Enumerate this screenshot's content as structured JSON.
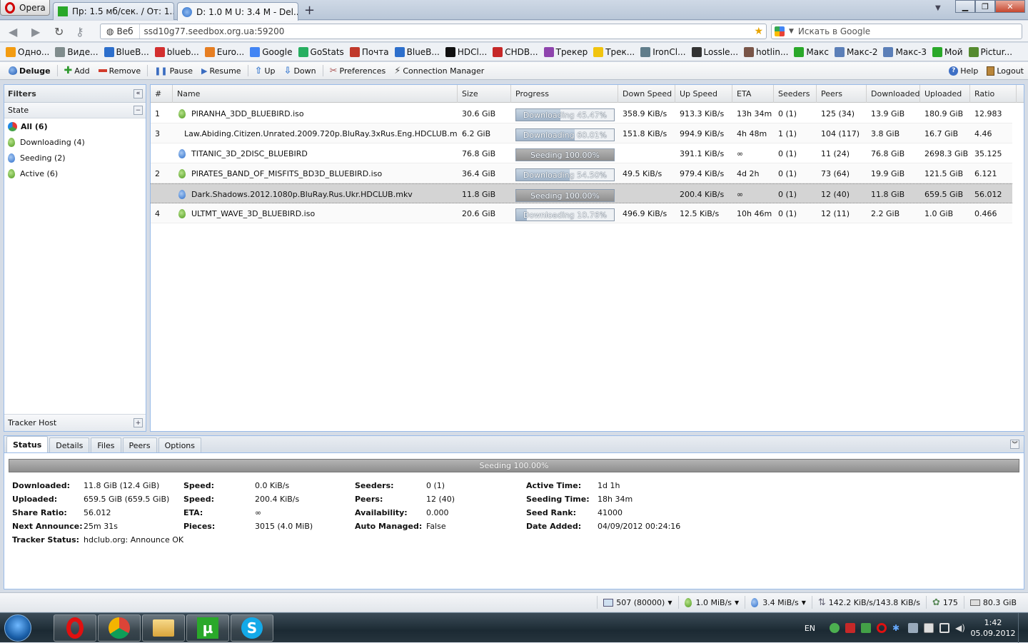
{
  "browser": {
    "menu_label": "Opera",
    "tabs": [
      {
        "title": "Пр: 1.5 мб/сек. / От: 1....",
        "active": false
      },
      {
        "title": "D: 1.0 M U: 3.4 M - Del...",
        "active": true
      }
    ],
    "new_tab": "+",
    "address": {
      "proto": "Веб",
      "url": "ssd10g77.seedbox.org.ua:59200"
    },
    "search_placeholder": "Искать в Google",
    "bookmarks": [
      "Одно...",
      "Виде...",
      "BlueB...",
      "blueb...",
      "Euro...",
      "Google",
      "GoStats",
      "Почта",
      "BlueB...",
      "HDCl...",
      "CHDB...",
      "Трекер",
      "Трек...",
      "IronCl...",
      "Lossle...",
      "hotlin...",
      "Макс",
      "Макс-2",
      "Макс-3",
      "Мой",
      "Pictur..."
    ]
  },
  "toolbar": {
    "brand": "Deluge",
    "add": "Add",
    "remove": "Remove",
    "pause": "Pause",
    "resume": "Resume",
    "up": "Up",
    "down": "Down",
    "preferences": "Preferences",
    "connection_manager": "Connection Manager",
    "help": "Help",
    "logout": "Logout"
  },
  "filters": {
    "title": "Filters",
    "state_header": "State",
    "items": [
      {
        "label": "All (6)",
        "icon": "all-icon",
        "selected": true
      },
      {
        "label": "Downloading (4)",
        "icon": "downloading-icon",
        "selected": false
      },
      {
        "label": "Seeding (2)",
        "icon": "seeding-icon",
        "selected": false
      },
      {
        "label": "Active (6)",
        "icon": "active-icon",
        "selected": false
      }
    ],
    "tracker_host": "Tracker Host"
  },
  "grid": {
    "columns": [
      "#",
      "Name",
      "Size",
      "Progress",
      "Down Speed",
      "Up Speed",
      "ETA",
      "Seeders",
      "Peers",
      "Downloaded",
      "Uploaded",
      "Ratio"
    ],
    "rows": [
      {
        "num": "1",
        "name": "PIRANHA_3DD_BLUEBIRD.iso",
        "size": "30.6 GiB",
        "progress_text": "Downloading 45.47%",
        "progress": 45.47,
        "state": "downloading",
        "down": "358.9 KiB/s",
        "up": "913.3 KiB/s",
        "eta": "13h 34m",
        "seeders": "0 (1)",
        "peers": "125 (34)",
        "downloaded": "13.9 GiB",
        "uploaded": "180.9 GiB",
        "ratio": "12.983",
        "selected": false
      },
      {
        "num": "3",
        "name": "Law.Abiding.Citizen.Unrated.2009.720p.BluRay.3xRus.Eng.HDCLUB.mkv",
        "size": "6.2 GiB",
        "progress_text": "Downloading 60.01%",
        "progress": 60.01,
        "state": "downloading",
        "down": "151.8 KiB/s",
        "up": "994.9 KiB/s",
        "eta": "4h 48m",
        "seeders": "1 (1)",
        "peers": "104 (117)",
        "downloaded": "3.8 GiB",
        "uploaded": "16.7 GiB",
        "ratio": "4.46",
        "selected": false
      },
      {
        "num": "",
        "name": "TITANIC_3D_2DISC_BLUEBIRD",
        "size": "76.8 GiB",
        "progress_text": "Seeding 100.00%",
        "progress": 100,
        "state": "seeding",
        "down": "",
        "up": "391.1 KiB/s",
        "eta": "∞",
        "seeders": "0 (1)",
        "peers": "11 (24)",
        "downloaded": "76.8 GiB",
        "uploaded": "2698.3 GiB",
        "ratio": "35.125",
        "selected": false
      },
      {
        "num": "2",
        "name": "PIRATES_BAND_OF_MISFITS_BD3D_BLUEBIRD.iso",
        "size": "36.4 GiB",
        "progress_text": "Downloading 54.50%",
        "progress": 54.5,
        "state": "downloading",
        "down": "49.5 KiB/s",
        "up": "979.4 KiB/s",
        "eta": "4d 2h",
        "seeders": "0 (1)",
        "peers": "73 (64)",
        "downloaded": "19.9 GiB",
        "uploaded": "121.5 GiB",
        "ratio": "6.121",
        "selected": false
      },
      {
        "num": "",
        "name": "Dark.Shadows.2012.1080p.BluRay.Rus.Ukr.HDCLUB.mkv",
        "size": "11.8 GiB",
        "progress_text": "Seeding 100.00%",
        "progress": 100,
        "state": "seeding",
        "down": "",
        "up": "200.4 KiB/s",
        "eta": "∞",
        "seeders": "0 (1)",
        "peers": "12 (40)",
        "downloaded": "11.8 GiB",
        "uploaded": "659.5 GiB",
        "ratio": "56.012",
        "selected": true
      },
      {
        "num": "4",
        "name": "ULTMT_WAVE_3D_BLUEBIRD.iso",
        "size": "20.6 GiB",
        "progress_text": "Downloading 10.76%",
        "progress": 10.76,
        "state": "downloading",
        "down": "496.9 KiB/s",
        "up": "12.5 KiB/s",
        "eta": "10h 46m",
        "seeders": "0 (1)",
        "peers": "12 (11)",
        "downloaded": "2.2 GiB",
        "uploaded": "1.0 GiB",
        "ratio": "0.466",
        "selected": false
      }
    ]
  },
  "details": {
    "tabs": [
      "Status",
      "Details",
      "Files",
      "Peers",
      "Options"
    ],
    "active_tab": "Status",
    "progress_text": "Seeding 100.00%",
    "progress": 100,
    "col1": [
      {
        "k": "Downloaded:",
        "v": "11.8 GiB (12.4 GiB)"
      },
      {
        "k": "Uploaded:",
        "v": "659.5 GiB (659.5 GiB)"
      },
      {
        "k": "Share Ratio:",
        "v": "56.012"
      },
      {
        "k": "Next Announce:",
        "v": "25m 31s"
      },
      {
        "k": "Tracker Status:",
        "v": "hdclub.org: Announce OK"
      }
    ],
    "col2": [
      {
        "k": "Speed:",
        "v": "0.0 KiB/s"
      },
      {
        "k": "Speed:",
        "v": "200.4 KiB/s"
      },
      {
        "k": "ETA:",
        "v": "∞"
      },
      {
        "k": "Pieces:",
        "v": "3015 (4.0 MiB)"
      }
    ],
    "col3": [
      {
        "k": "Seeders:",
        "v": "0 (1)"
      },
      {
        "k": "Peers:",
        "v": "12 (40)"
      },
      {
        "k": "Availability:",
        "v": "0.000"
      },
      {
        "k": "Auto Managed:",
        "v": "False"
      }
    ],
    "col4": [
      {
        "k": "Active Time:",
        "v": "1d 1h"
      },
      {
        "k": "Seeding Time:",
        "v": "18h 34m"
      },
      {
        "k": "Seed Rank:",
        "v": "41000"
      },
      {
        "k": "Date Added:",
        "v": "04/09/2012 00:24:16"
      }
    ]
  },
  "statusbar": {
    "connections": "507 (80000)",
    "down_speed": "1.0 MiB/s",
    "up_speed": "3.4 MiB/s",
    "protocol": "142.2 KiB/s/143.8 KiB/s",
    "dht": "175",
    "free_space": "80.3 GiB"
  },
  "taskbar": {
    "lang": "EN",
    "time": "1:42",
    "date": "05.09.2012"
  }
}
